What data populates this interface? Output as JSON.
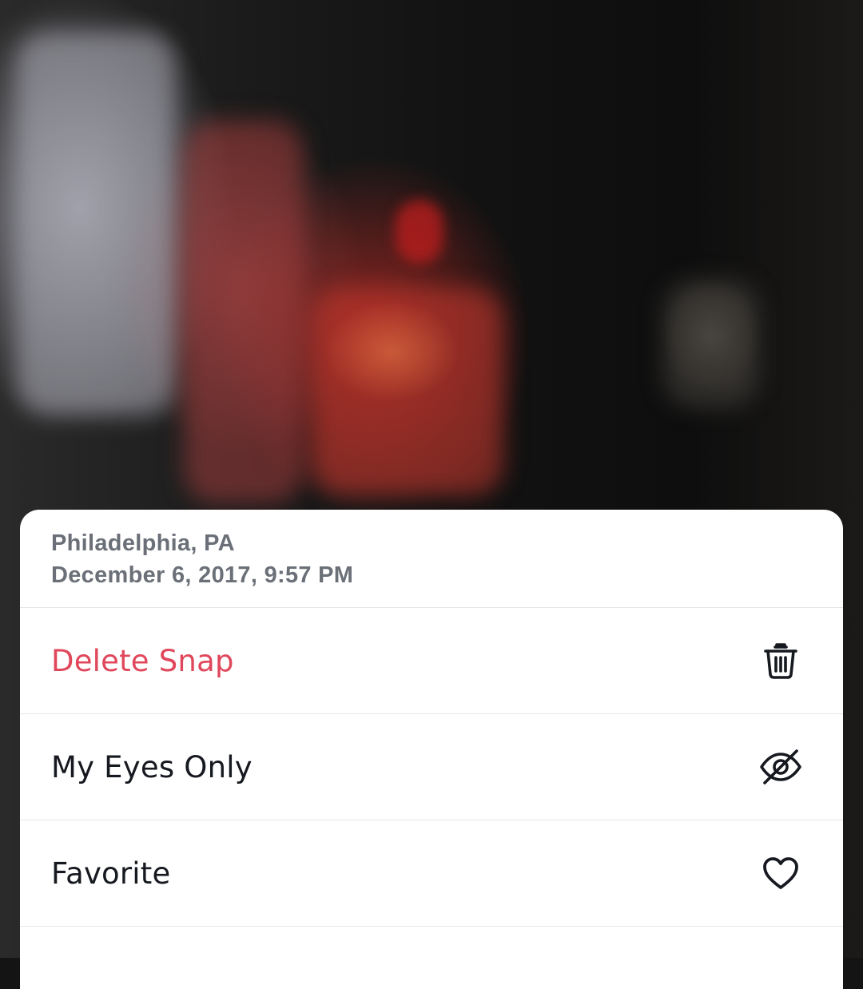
{
  "snap_info": {
    "location": "Philadelphia, PA",
    "timestamp": "December 6, 2017, 9:57 PM"
  },
  "actions": [
    {
      "label": "Delete Snap",
      "icon": "trash-icon",
      "color": "#e0475a"
    },
    {
      "label": "My Eyes Only",
      "icon": "eye-slash-icon",
      "color": "#16191f"
    },
    {
      "label": "Favorite",
      "icon": "heart-outline-icon",
      "color": "#16191f"
    }
  ],
  "colors": {
    "sheet_background": "#ffffff",
    "meta_text": "#6b7078",
    "destructive": "#e0475a",
    "primary_text": "#16191f"
  }
}
